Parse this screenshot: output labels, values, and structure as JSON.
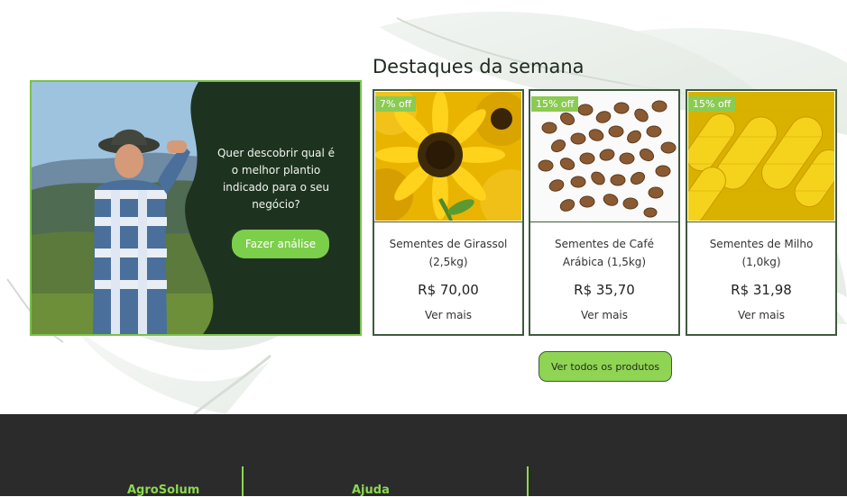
{
  "section": {
    "title": "Destaques da semana"
  },
  "promo": {
    "text": "Quer descobrir qual é o melhor plantio indicado para o seu negócio?",
    "button_label": "Fazer análise"
  },
  "products": [
    {
      "badge": "7% off",
      "name": "Sementes de Girassol (2,5kg)",
      "price": "R$ 70,00",
      "link": "Ver mais",
      "image": "sunflower"
    },
    {
      "badge": "15% off",
      "name": "Sementes de Café Arábica (1,5kg)",
      "price": "R$ 35,70",
      "link": "Ver mais",
      "image": "coffee-beans"
    },
    {
      "badge": "15% off",
      "name": "Sementes de Milho (1,0kg)",
      "price": "R$ 31,98",
      "link": "Ver mais",
      "image": "corn"
    }
  ],
  "all_products_label": "Ver todos os produtos",
  "footer": {
    "columns": [
      {
        "title": "AgroSolum"
      },
      {
        "title": "Ajuda"
      }
    ]
  },
  "colors": {
    "accent_green": "#7ccf4a",
    "promo_bg": "#1d3320",
    "footer_bg": "#2b2b2b",
    "footer_title": "#8bd94e"
  }
}
